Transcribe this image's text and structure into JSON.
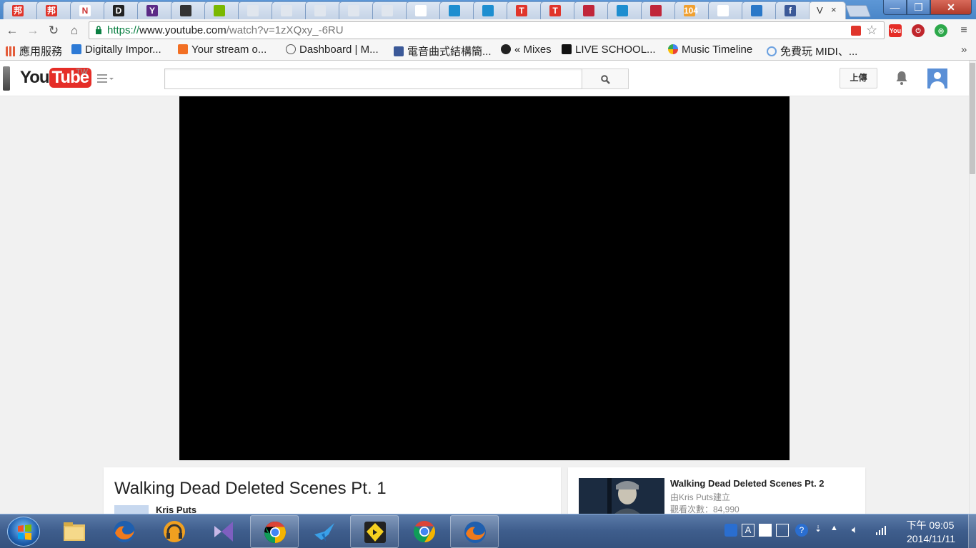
{
  "browser": {
    "tabs": [
      {
        "label": "邦",
        "color": "#e0352b",
        "icon": "tab-favicon-bang"
      },
      {
        "label": "邦",
        "color": "#e0352b",
        "icon": "tab-favicon-bang"
      },
      {
        "label": "N",
        "color": "#ffffff",
        "icon": "tab-favicon-n"
      },
      {
        "label": "D",
        "color": "#222222",
        "icon": "tab-favicon-d"
      },
      {
        "label": "Y",
        "color": "#5b2a86",
        "icon": "tab-favicon-y"
      },
      {
        "label": "",
        "color": "#333333",
        "icon": "tab-favicon-media"
      },
      {
        "label": "",
        "color": "#7ab800",
        "icon": "tab-favicon-spotify"
      },
      {
        "label": "",
        "color": "#e0e6ee",
        "icon": "tab-favicon-bulb"
      },
      {
        "label": "",
        "color": "#e0e6ee",
        "icon": "tab-favicon-bulb"
      },
      {
        "label": "",
        "color": "#e0e6ee",
        "icon": "tab-favicon-bulb"
      },
      {
        "label": "",
        "color": "#e0e6ee",
        "icon": "tab-favicon-bulb"
      },
      {
        "label": "",
        "color": "#e0e6ee",
        "icon": "tab-favicon-bulb"
      },
      {
        "label": "",
        "color": "#ffffff",
        "icon": "tab-favicon-doc"
      },
      {
        "label": "",
        "color": "#1d8ed0",
        "icon": "tab-favicon-wave"
      },
      {
        "label": "",
        "color": "#1d8ed0",
        "icon": "tab-favicon-wave"
      },
      {
        "label": "T",
        "color": "#e0352b",
        "icon": "tab-favicon-t"
      },
      {
        "label": "T",
        "color": "#e0352b",
        "icon": "tab-favicon-t"
      },
      {
        "label": "",
        "color": "#c0263a",
        "icon": "tab-favicon-red"
      },
      {
        "label": "",
        "color": "#1d8ed0",
        "icon": "tab-favicon-wave"
      },
      {
        "label": "",
        "color": "#c0263a",
        "icon": "tab-favicon-pocket"
      },
      {
        "label": "104",
        "color": "#f0a030",
        "icon": "tab-favicon-104"
      },
      {
        "label": "",
        "color": "#ffffff",
        "icon": "tab-favicon-doc"
      },
      {
        "label": "",
        "color": "#2a78c8",
        "icon": "tab-favicon-power"
      },
      {
        "label": "f",
        "color": "#3b5998",
        "icon": "tab-favicon-facebook"
      }
    ],
    "active_tab": {
      "title": "V",
      "close": "×"
    },
    "window_buttons": {
      "min": "—",
      "max": "❐",
      "close": "✕"
    },
    "nav": {
      "back": "←",
      "forward": "→",
      "reload": "↻",
      "home": "⌂"
    },
    "url": {
      "scheme": "https://",
      "host": "www.youtube.com",
      "path": "/watch?v=1zXQxy_-6RU"
    },
    "bookmarks": [
      {
        "label": "應用服務",
        "color": "#e45c3a"
      },
      {
        "label": "Digitally Impor...",
        "color": "#2d7ad6"
      },
      {
        "label": "Your stream o...",
        "color": "#f26f23"
      },
      {
        "label": "Dashboard | M...",
        "color": "#555555"
      },
      {
        "label": "電音曲式結構簡...",
        "color": "#3b5998"
      },
      {
        "label": "« Mixes",
        "color": "#222222"
      },
      {
        "label": "LIVE SCHOOL...",
        "color": "#111111"
      },
      {
        "label": "Music Timeline",
        "color": "#4285f4"
      },
      {
        "label": "免費玩 MIDI、...",
        "color": "#6aa0e0"
      }
    ],
    "bookmarks_overflow": "»"
  },
  "youtube": {
    "logo_you": "You",
    "logo_tube": "Tube",
    "country": "TW",
    "search_placeholder": "",
    "upload_label": "上傳",
    "video_title": "Walking Dead Deleted Scenes Pt. 1",
    "channel_name": "Kris Puts",
    "related": {
      "title": "Walking Dead Deleted Scenes Pt. 2",
      "by": "由Kris Puts建立",
      "views": "觀看次數：84,990"
    },
    "accent": "#e52d27"
  },
  "taskbar": {
    "apps": [
      {
        "name": "explorer",
        "open": false
      },
      {
        "name": "firefox",
        "open": false
      },
      {
        "name": "headphones-app",
        "open": false
      },
      {
        "name": "visual-studio",
        "open": false
      },
      {
        "name": "chrome",
        "open": true
      },
      {
        "name": "bird-app",
        "open": false
      },
      {
        "name": "yellow-app",
        "open": true
      },
      {
        "name": "chrome-2",
        "open": false
      },
      {
        "name": "firefox-2",
        "open": true
      }
    ],
    "clock_time": "下午 09:05",
    "clock_date": "2014/11/11"
  }
}
